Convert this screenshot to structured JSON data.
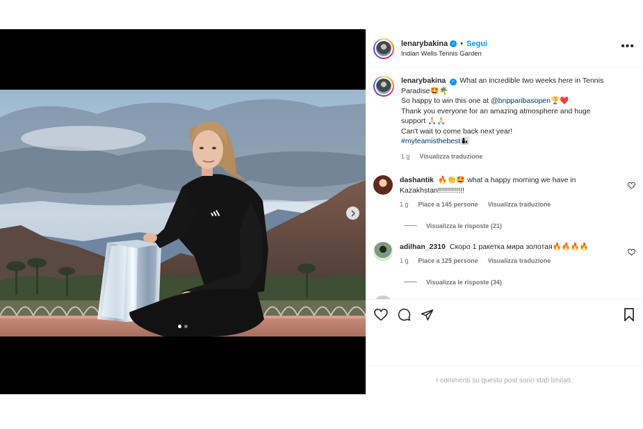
{
  "post": {
    "username": "lenarybakina",
    "follow_label": "Segui",
    "separator": "•",
    "location": "Indian Wells Tennis Garden",
    "more_glyph": "•••",
    "caption_lines": {
      "l1": "What an incredible two weeks here in Tennis",
      "l2": "Paradise🤩🌴",
      "l3_pre": "So happy to win this one at ",
      "l3_mention": "@bnpparibasopen",
      "l3_post": "🏆❤️",
      "l4": "Thank you everyone for an amazing atmosphere and huge",
      "l5": "support 🙏🏻🙏🏻",
      "l6": "Can't wait to come back next year!",
      "l7_hashtag": "#myteamisthebest",
      "l7_emoji": "👩‍👦"
    },
    "caption_time": "1 g",
    "caption_translate": "Visualizza traduzione",
    "slides_total": 2,
    "active_slide": 1
  },
  "comments": [
    {
      "username": "dashantik",
      "text": "🔥👏🤩 what a happy morning we have in\nKazakhstan!!!!!!!!!!!!!",
      "time": "1 g",
      "likes": "Piace a 145 persone",
      "translate": "Visualizza traduzione",
      "replies": "Visualizza le risposte (21)"
    },
    {
      "username": "adilhan_2310",
      "text": "Скоро 1 ракетка мира золотая🔥🔥🔥🔥",
      "time": "1 g",
      "likes": "Piace a 125 persone",
      "translate": "Visualizza traduzione",
      "replies": "Visualizza le risposte (34)"
    }
  ],
  "footer": {
    "limited_text": "I commenti su questo post sono stati limitati."
  },
  "colors": {
    "link": "#0095f6",
    "hashtag": "#00376b",
    "muted": "#737373"
  }
}
